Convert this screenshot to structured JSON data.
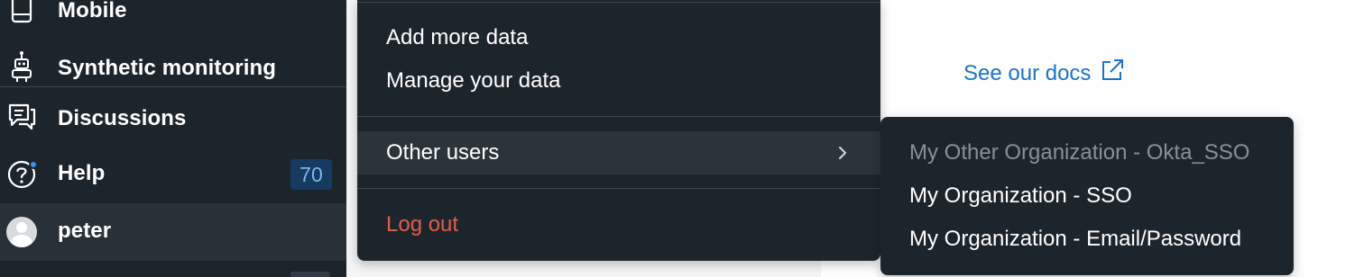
{
  "sidebar": {
    "items": [
      {
        "label": "Mobile",
        "icon": "mobile-icon"
      },
      {
        "label": "Synthetic monitoring",
        "icon": "robot-icon"
      },
      {
        "label": "Discussions",
        "icon": "chat-icon"
      },
      {
        "label": "Help",
        "icon": "help-circle-icon",
        "badge": "70"
      },
      {
        "label": "peter",
        "icon": "avatar"
      }
    ]
  },
  "main": {
    "docs_link": {
      "label": "See our docs",
      "icon": "external-link-icon"
    }
  },
  "user_menu": {
    "items": [
      {
        "label": "Add more data"
      },
      {
        "label": "Manage your data"
      },
      {
        "label": "Other users",
        "icon": "chevron-right-icon"
      },
      {
        "label": "Log out"
      }
    ]
  },
  "other_users_submenu": {
    "items": [
      {
        "label": "My Other Organization - Okta_SSO",
        "state": "disabled"
      },
      {
        "label": "My Organization - SSO"
      },
      {
        "label": "My Organization - Email/Password"
      }
    ]
  },
  "colors": {
    "sidebar_bg": "#1d252c",
    "link_blue": "#1d74c8",
    "danger_red": "#e25d4d",
    "badge_bg": "#163a60"
  }
}
